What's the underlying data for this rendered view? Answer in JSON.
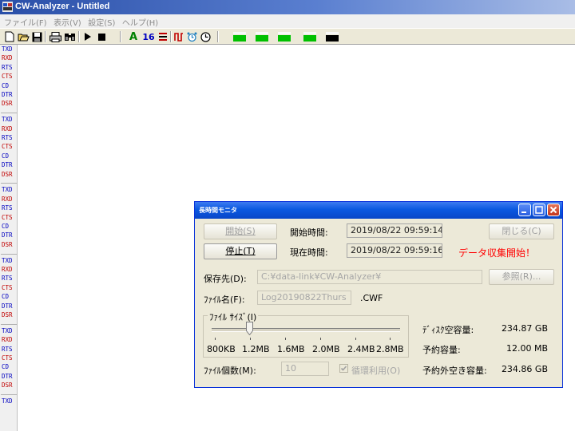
{
  "window": {
    "title": "CW-Analyzer - Untitled"
  },
  "menu": [
    "ファイル(F)",
    "表示(V)",
    "設定(S)",
    "ヘルプ(H)"
  ],
  "toolbar": {
    "icons": [
      "new-file-icon",
      "open-folder-icon",
      "save-icon",
      "print-icon",
      "find-icon",
      "play-icon",
      "stop-icon",
      "text-mode-icon",
      "hex-mode-icon",
      "line-mode-icon",
      "pulse-icon",
      "alarm-icon",
      "clock-icon",
      "led-icon",
      "led-icon",
      "led-icon",
      "led-icon",
      "led-icon"
    ],
    "text_icon_label": "A",
    "hex_icon_label": "16",
    "led_colors": [
      "#00c000",
      "#000000"
    ]
  },
  "signals": {
    "names": [
      "TXD",
      "RXD",
      "RTS",
      "CTS",
      "CD",
      "DTR",
      "DSR"
    ],
    "colors": {
      "TXD": "#0000c0",
      "RXD": "#c00000",
      "RTS": "#0000c0",
      "CTS": "#c00000",
      "CD": "#0000c0",
      "DTR": "#0000c0",
      "DSR": "#c00000"
    },
    "last_visible": "TXD"
  },
  "dialog": {
    "title": "長時間モニタ",
    "start_button": "開始(S)",
    "stop_button": "停止(T)",
    "close_button": "閉じる(C)",
    "start_time_label": "開始時間:",
    "start_time_value": "2019/08/22 09:59:14",
    "current_time_label": "現在時間:",
    "current_time_value": "2019/08/22 09:59:16",
    "status_message": "データ収集開始！",
    "status_color": "#ff0000",
    "save_dest_label": "保存先(D):",
    "save_dest_value": "C:¥data-link¥CW-Analyzer¥",
    "browse_button": "参照(R)...",
    "filename_label": "ﾌｧｲﾙ名(F):",
    "filename_value": "Log20190822Thurs",
    "filename_ext": ".CWF",
    "filesize_group": "ﾌｧｲﾙ ｻｲｽﾞ(I)",
    "filesize_ticks": [
      "800KB",
      "1.2MB",
      "1.6MB",
      "2.0MB",
      "2.4MB",
      "2.8MB"
    ],
    "filesize_selected": "1.2MB",
    "filecount_label": "ﾌｧｲﾙ個数(M):",
    "filecount_value": "10",
    "cyclic_label": "循環利用(O)",
    "cyclic_checked": true,
    "disk_free_label": "ﾃﾞｨｽｸ空容量:",
    "disk_free_value": "234.87 GB",
    "reserved_label": "予約容量:",
    "reserved_value": "12.00 MB",
    "free_outside_label": "予約外空き容量:",
    "free_outside_value": "234.86 GB"
  }
}
